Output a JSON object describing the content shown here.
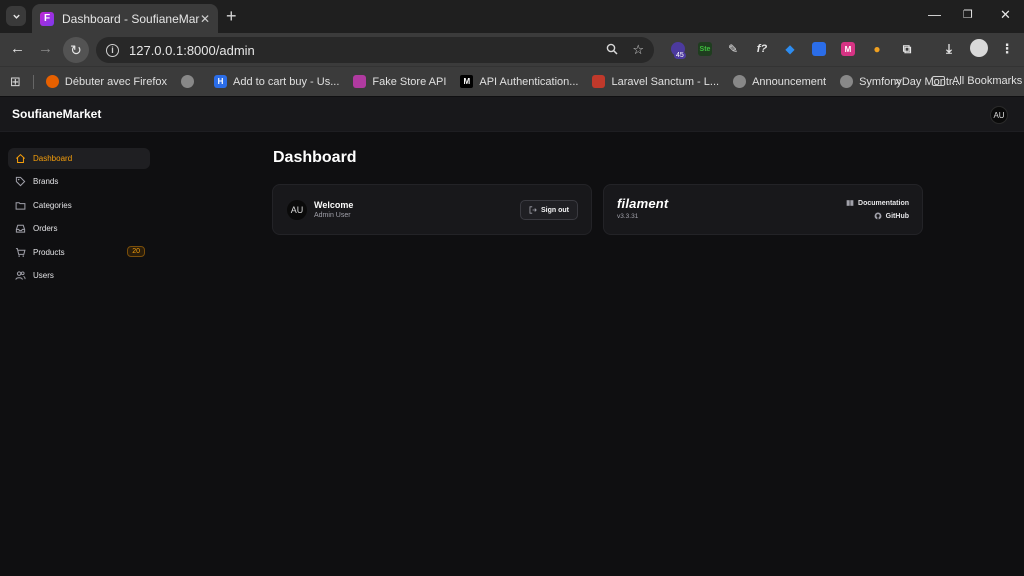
{
  "browser": {
    "tab_title": "Dashboard - SoufianeMarket",
    "tab_favicon": "F",
    "url": "127.0.0.1:8000/admin",
    "extension_badge": "45",
    "bookmarks": [
      {
        "label": "Débuter avec Firefox",
        "icon": "firefox-icon",
        "color": "#e66000"
      },
      {
        "label": "",
        "icon": "globe-icon",
        "color": "#888888"
      },
      {
        "label": "Add to cart buy - Us...",
        "icon": "hi-icon",
        "color": "#2b6de8"
      },
      {
        "label": "Fake Store API",
        "icon": "store-icon",
        "color": "#b03aa0"
      },
      {
        "label": "API Authentication...",
        "icon": "medium-icon",
        "color": "#000000"
      },
      {
        "label": "Laravel Sanctum - L...",
        "icon": "laravel-icon",
        "color": "#c0392b"
      },
      {
        "label": "Announcement",
        "icon": "globe-icon",
        "color": "#888888"
      },
      {
        "label": "SymfonyDay Montr...",
        "icon": "globe-icon",
        "color": "#888888"
      }
    ],
    "all_bookmarks": "All Bookmarks",
    "more": "»"
  },
  "app": {
    "brand": "SoufianeMarket",
    "user_initials": "AU",
    "accent_color": "#f59e0b"
  },
  "sidebar": {
    "items": [
      {
        "label": "Dashboard",
        "icon": "home-icon",
        "active": true
      },
      {
        "label": "Brands",
        "icon": "tag-icon",
        "active": false
      },
      {
        "label": "Categories",
        "icon": "folder-icon",
        "active": false
      },
      {
        "label": "Orders",
        "icon": "inbox-icon",
        "active": false
      },
      {
        "label": "Products",
        "icon": "cart-icon",
        "active": false,
        "badge": "20"
      },
      {
        "label": "Users",
        "icon": "users-icon",
        "active": false
      }
    ]
  },
  "main": {
    "title": "Dashboard",
    "welcome": {
      "initials": "AU",
      "title": "Welcome",
      "subtitle": "Admin User",
      "signout_label": "Sign out"
    },
    "filament": {
      "logo": "filament",
      "version": "v3.3.31",
      "docs_label": "Documentation",
      "github_label": "GitHub"
    }
  }
}
